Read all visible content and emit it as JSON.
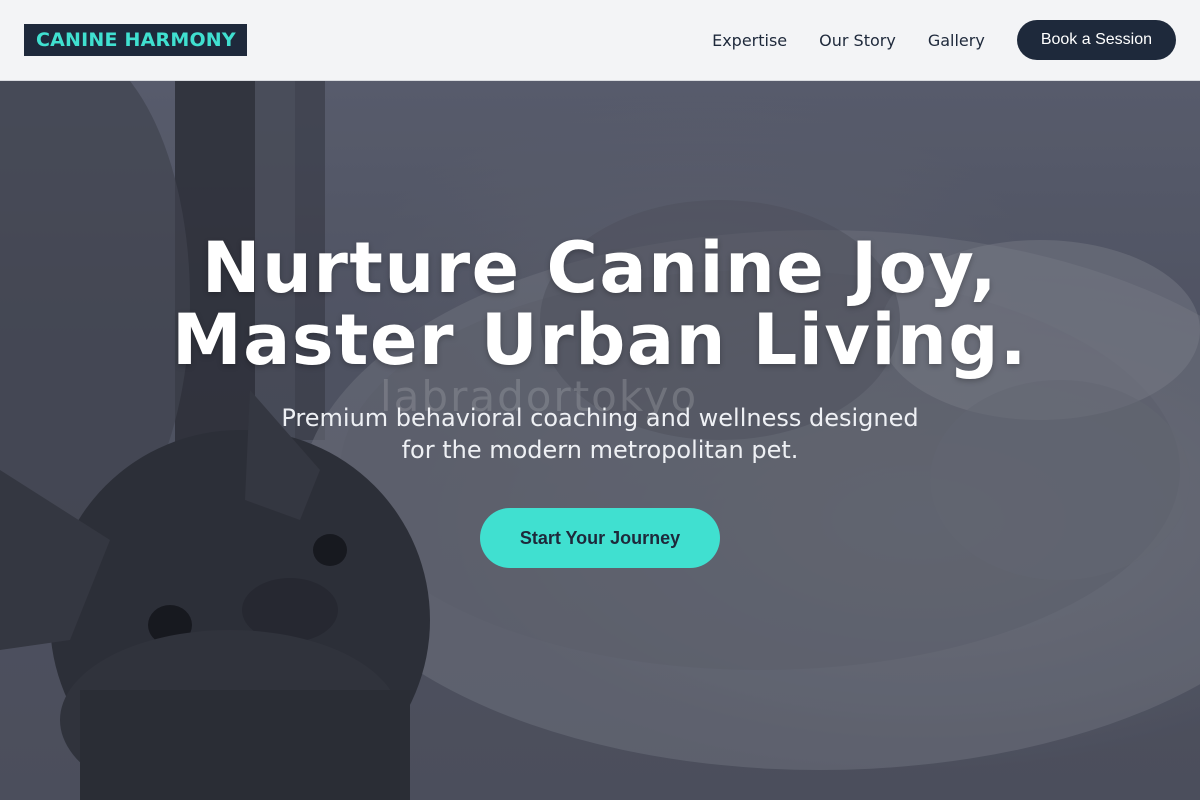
{
  "header": {
    "logo": "CANINE HARMONY",
    "nav": [
      "Expertise",
      "Our Story",
      "Gallery"
    ],
    "cta": "Book a Session"
  },
  "hero": {
    "title_line1": "Nurture Canine Joy,",
    "title_line2": "Master Urban Living.",
    "subtitle_line1": "Premium behavioral coaching and wellness designed",
    "subtitle_line2": "for the modern metropolitan pet.",
    "cta": "Start Your Journey",
    "watermark": "labradortokyo"
  },
  "colors": {
    "accent": "#40e0d0",
    "dark": "#1e293b",
    "header_bg": "#f3f4f6"
  }
}
